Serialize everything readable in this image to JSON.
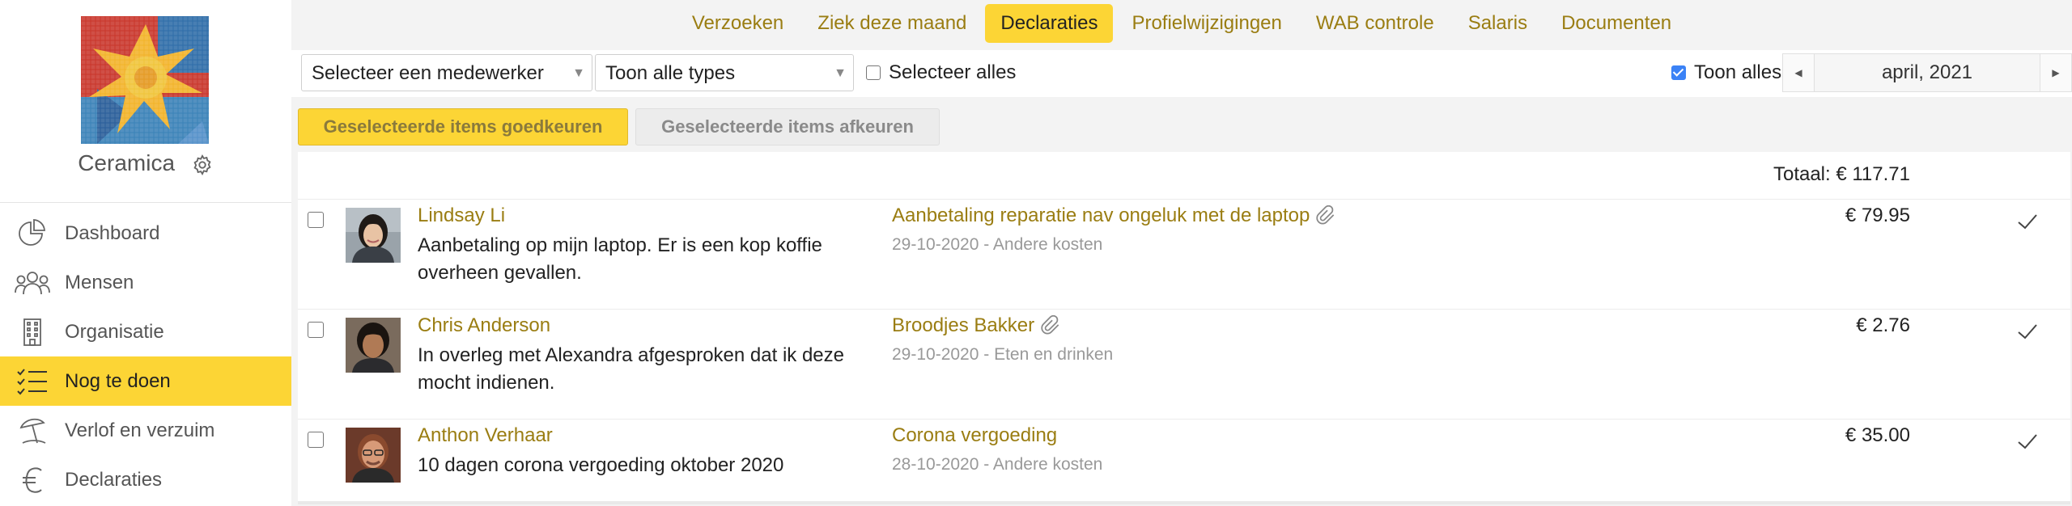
{
  "company": {
    "name": "Ceramica"
  },
  "sidebar": {
    "items": [
      {
        "label": "Dashboard",
        "icon": "pie-chart-icon",
        "active": false
      },
      {
        "label": "Mensen",
        "icon": "people-icon",
        "active": false
      },
      {
        "label": "Organisatie",
        "icon": "building-icon",
        "active": false
      },
      {
        "label": "Nog te doen",
        "icon": "checklist-icon",
        "active": true
      },
      {
        "label": "Verlof en verzuim",
        "icon": "beach-umbrella-icon",
        "active": false
      },
      {
        "label": "Declaraties",
        "icon": "euro-icon",
        "active": false
      }
    ]
  },
  "tabs": [
    {
      "label": "Verzoeken",
      "active": false
    },
    {
      "label": "Ziek deze maand",
      "active": false
    },
    {
      "label": "Declaraties",
      "active": true
    },
    {
      "label": "Profielwijzigingen",
      "active": false
    },
    {
      "label": "WAB controle",
      "active": false
    },
    {
      "label": "Salaris",
      "active": false
    },
    {
      "label": "Documenten",
      "active": false
    }
  ],
  "filters": {
    "employee_select": "Selecteer een medewerker",
    "type_select": "Toon alle types",
    "select_all_label": "Selecteer alles",
    "select_all_checked": false,
    "show_all_label": "Toon alles",
    "show_all_checked": true,
    "month": "april, 2021"
  },
  "actions": {
    "approve_label": "Geselecteerde items goedkeuren",
    "reject_label": "Geselecteerde items afkeuren"
  },
  "total": "Totaal: € 117.71",
  "rows": [
    {
      "name": "Lindsay Li",
      "note": "Aanbetaling op mijn laptop. Er is een kop koffie overheen gevallen.",
      "title": "Aanbetaling reparatie nav ongeluk met de laptop",
      "attachment": true,
      "meta": "29-10-2020 - Andere kosten",
      "amount": "€ 79.95"
    },
    {
      "name": "Chris Anderson",
      "note": "In overleg met Alexandra afgesproken dat ik deze mocht indienen.",
      "title": "Broodjes Bakker",
      "attachment": true,
      "meta": "29-10-2020 - Eten en drinken",
      "amount": "€ 2.76"
    },
    {
      "name": "Anthon Verhaar",
      "note": "10 dagen corona vergoeding oktober 2020",
      "title": "Corona vergoeding",
      "attachment": false,
      "meta": "28-10-2020 - Andere kosten",
      "amount": "€ 35.00"
    }
  ],
  "colors": {
    "accent": "#fcd535",
    "link": "#9a7d12"
  }
}
